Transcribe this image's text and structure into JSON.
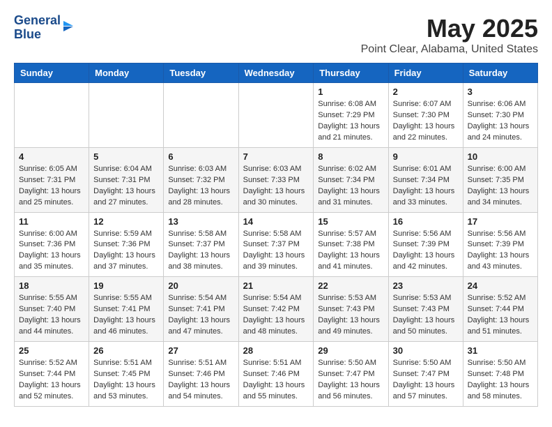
{
  "header": {
    "logo_line1": "General",
    "logo_line2": "Blue",
    "month": "May 2025",
    "location": "Point Clear, Alabama, United States"
  },
  "weekdays": [
    "Sunday",
    "Monday",
    "Tuesday",
    "Wednesday",
    "Thursday",
    "Friday",
    "Saturday"
  ],
  "weeks": [
    [
      {
        "day": "",
        "sunrise": "",
        "sunset": "",
        "daylight": ""
      },
      {
        "day": "",
        "sunrise": "",
        "sunset": "",
        "daylight": ""
      },
      {
        "day": "",
        "sunrise": "",
        "sunset": "",
        "daylight": ""
      },
      {
        "day": "",
        "sunrise": "",
        "sunset": "",
        "daylight": ""
      },
      {
        "day": "1",
        "sunrise": "Sunrise: 6:08 AM",
        "sunset": "Sunset: 7:29 PM",
        "daylight": "Daylight: 13 hours and 21 minutes."
      },
      {
        "day": "2",
        "sunrise": "Sunrise: 6:07 AM",
        "sunset": "Sunset: 7:30 PM",
        "daylight": "Daylight: 13 hours and 22 minutes."
      },
      {
        "day": "3",
        "sunrise": "Sunrise: 6:06 AM",
        "sunset": "Sunset: 7:30 PM",
        "daylight": "Daylight: 13 hours and 24 minutes."
      }
    ],
    [
      {
        "day": "4",
        "sunrise": "Sunrise: 6:05 AM",
        "sunset": "Sunset: 7:31 PM",
        "daylight": "Daylight: 13 hours and 25 minutes."
      },
      {
        "day": "5",
        "sunrise": "Sunrise: 6:04 AM",
        "sunset": "Sunset: 7:31 PM",
        "daylight": "Daylight: 13 hours and 27 minutes."
      },
      {
        "day": "6",
        "sunrise": "Sunrise: 6:03 AM",
        "sunset": "Sunset: 7:32 PM",
        "daylight": "Daylight: 13 hours and 28 minutes."
      },
      {
        "day": "7",
        "sunrise": "Sunrise: 6:03 AM",
        "sunset": "Sunset: 7:33 PM",
        "daylight": "Daylight: 13 hours and 30 minutes."
      },
      {
        "day": "8",
        "sunrise": "Sunrise: 6:02 AM",
        "sunset": "Sunset: 7:34 PM",
        "daylight": "Daylight: 13 hours and 31 minutes."
      },
      {
        "day": "9",
        "sunrise": "Sunrise: 6:01 AM",
        "sunset": "Sunset: 7:34 PM",
        "daylight": "Daylight: 13 hours and 33 minutes."
      },
      {
        "day": "10",
        "sunrise": "Sunrise: 6:00 AM",
        "sunset": "Sunset: 7:35 PM",
        "daylight": "Daylight: 13 hours and 34 minutes."
      }
    ],
    [
      {
        "day": "11",
        "sunrise": "Sunrise: 6:00 AM",
        "sunset": "Sunset: 7:36 PM",
        "daylight": "Daylight: 13 hours and 35 minutes."
      },
      {
        "day": "12",
        "sunrise": "Sunrise: 5:59 AM",
        "sunset": "Sunset: 7:36 PM",
        "daylight": "Daylight: 13 hours and 37 minutes."
      },
      {
        "day": "13",
        "sunrise": "Sunrise: 5:58 AM",
        "sunset": "Sunset: 7:37 PM",
        "daylight": "Daylight: 13 hours and 38 minutes."
      },
      {
        "day": "14",
        "sunrise": "Sunrise: 5:58 AM",
        "sunset": "Sunset: 7:37 PM",
        "daylight": "Daylight: 13 hours and 39 minutes."
      },
      {
        "day": "15",
        "sunrise": "Sunrise: 5:57 AM",
        "sunset": "Sunset: 7:38 PM",
        "daylight": "Daylight: 13 hours and 41 minutes."
      },
      {
        "day": "16",
        "sunrise": "Sunrise: 5:56 AM",
        "sunset": "Sunset: 7:39 PM",
        "daylight": "Daylight: 13 hours and 42 minutes."
      },
      {
        "day": "17",
        "sunrise": "Sunrise: 5:56 AM",
        "sunset": "Sunset: 7:39 PM",
        "daylight": "Daylight: 13 hours and 43 minutes."
      }
    ],
    [
      {
        "day": "18",
        "sunrise": "Sunrise: 5:55 AM",
        "sunset": "Sunset: 7:40 PM",
        "daylight": "Daylight: 13 hours and 44 minutes."
      },
      {
        "day": "19",
        "sunrise": "Sunrise: 5:55 AM",
        "sunset": "Sunset: 7:41 PM",
        "daylight": "Daylight: 13 hours and 46 minutes."
      },
      {
        "day": "20",
        "sunrise": "Sunrise: 5:54 AM",
        "sunset": "Sunset: 7:41 PM",
        "daylight": "Daylight: 13 hours and 47 minutes."
      },
      {
        "day": "21",
        "sunrise": "Sunrise: 5:54 AM",
        "sunset": "Sunset: 7:42 PM",
        "daylight": "Daylight: 13 hours and 48 minutes."
      },
      {
        "day": "22",
        "sunrise": "Sunrise: 5:53 AM",
        "sunset": "Sunset: 7:43 PM",
        "daylight": "Daylight: 13 hours and 49 minutes."
      },
      {
        "day": "23",
        "sunrise": "Sunrise: 5:53 AM",
        "sunset": "Sunset: 7:43 PM",
        "daylight": "Daylight: 13 hours and 50 minutes."
      },
      {
        "day": "24",
        "sunrise": "Sunrise: 5:52 AM",
        "sunset": "Sunset: 7:44 PM",
        "daylight": "Daylight: 13 hours and 51 minutes."
      }
    ],
    [
      {
        "day": "25",
        "sunrise": "Sunrise: 5:52 AM",
        "sunset": "Sunset: 7:44 PM",
        "daylight": "Daylight: 13 hours and 52 minutes."
      },
      {
        "day": "26",
        "sunrise": "Sunrise: 5:51 AM",
        "sunset": "Sunset: 7:45 PM",
        "daylight": "Daylight: 13 hours and 53 minutes."
      },
      {
        "day": "27",
        "sunrise": "Sunrise: 5:51 AM",
        "sunset": "Sunset: 7:46 PM",
        "daylight": "Daylight: 13 hours and 54 minutes."
      },
      {
        "day": "28",
        "sunrise": "Sunrise: 5:51 AM",
        "sunset": "Sunset: 7:46 PM",
        "daylight": "Daylight: 13 hours and 55 minutes."
      },
      {
        "day": "29",
        "sunrise": "Sunrise: 5:50 AM",
        "sunset": "Sunset: 7:47 PM",
        "daylight": "Daylight: 13 hours and 56 minutes."
      },
      {
        "day": "30",
        "sunrise": "Sunrise: 5:50 AM",
        "sunset": "Sunset: 7:47 PM",
        "daylight": "Daylight: 13 hours and 57 minutes."
      },
      {
        "day": "31",
        "sunrise": "Sunrise: 5:50 AM",
        "sunset": "Sunset: 7:48 PM",
        "daylight": "Daylight: 13 hours and 58 minutes."
      }
    ]
  ]
}
